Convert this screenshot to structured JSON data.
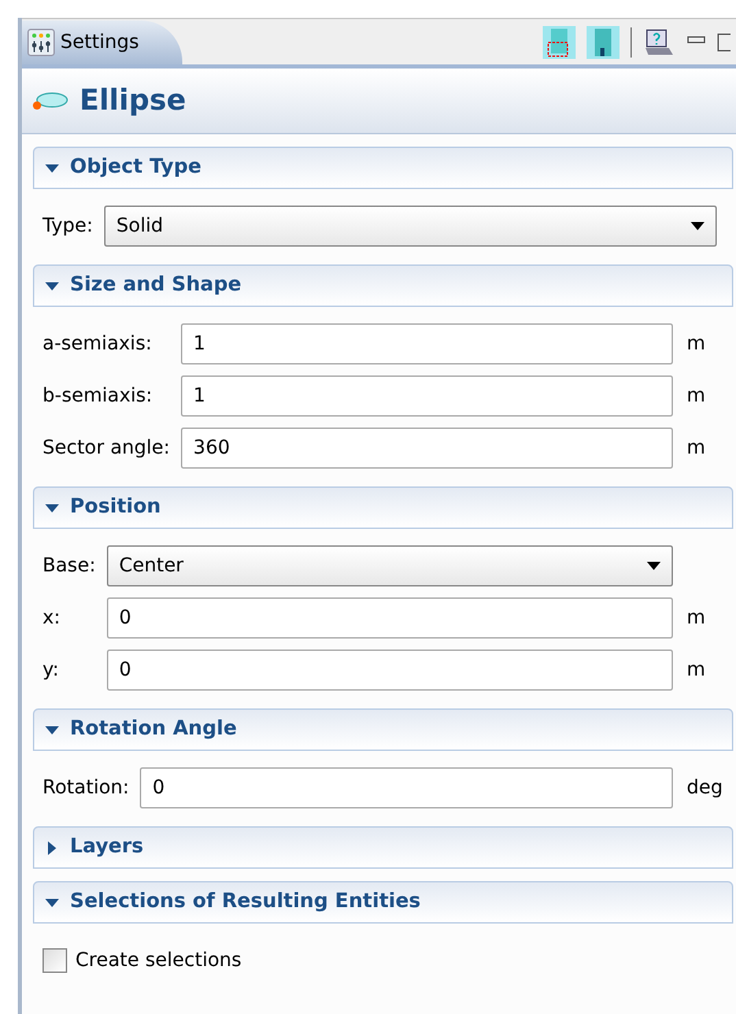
{
  "tab": {
    "label": "Settings",
    "selected": true
  },
  "title": "Ellipse",
  "sections": [
    {
      "title": "Object Type",
      "expanded": true,
      "rows": [
        {
          "kind": "select",
          "label": "Type:",
          "value": "Solid"
        }
      ]
    },
    {
      "title": "Size and Shape",
      "expanded": true,
      "rows": [
        {
          "kind": "field",
          "label": "a-semiaxis:",
          "value": "1",
          "unit": "m"
        },
        {
          "kind": "field",
          "label": "b-semiaxis:",
          "value": "1",
          "unit": "m"
        },
        {
          "kind": "field",
          "label": "Sector angle:",
          "value": "360",
          "unit": "m"
        }
      ]
    },
    {
      "title": "Position",
      "expanded": true,
      "rows": [
        {
          "kind": "select",
          "label": "Base:",
          "value": "Center"
        },
        {
          "kind": "field",
          "label": "x:",
          "value": "0",
          "unit": "m"
        },
        {
          "kind": "field",
          "label": "y:",
          "value": "0",
          "unit": "m"
        }
      ]
    },
    {
      "title": "Rotation Angle",
      "expanded": true,
      "rows": [
        {
          "kind": "field",
          "label": "Rotation:",
          "value": "0",
          "unit": "deg"
        }
      ]
    },
    {
      "title": "Layers",
      "expanded": false
    },
    {
      "title": "Selections of Resulting Entities",
      "expanded": true,
      "rows": [
        {
          "kind": "checkbox",
          "label": "Create selections",
          "checked": false
        }
      ]
    }
  ]
}
